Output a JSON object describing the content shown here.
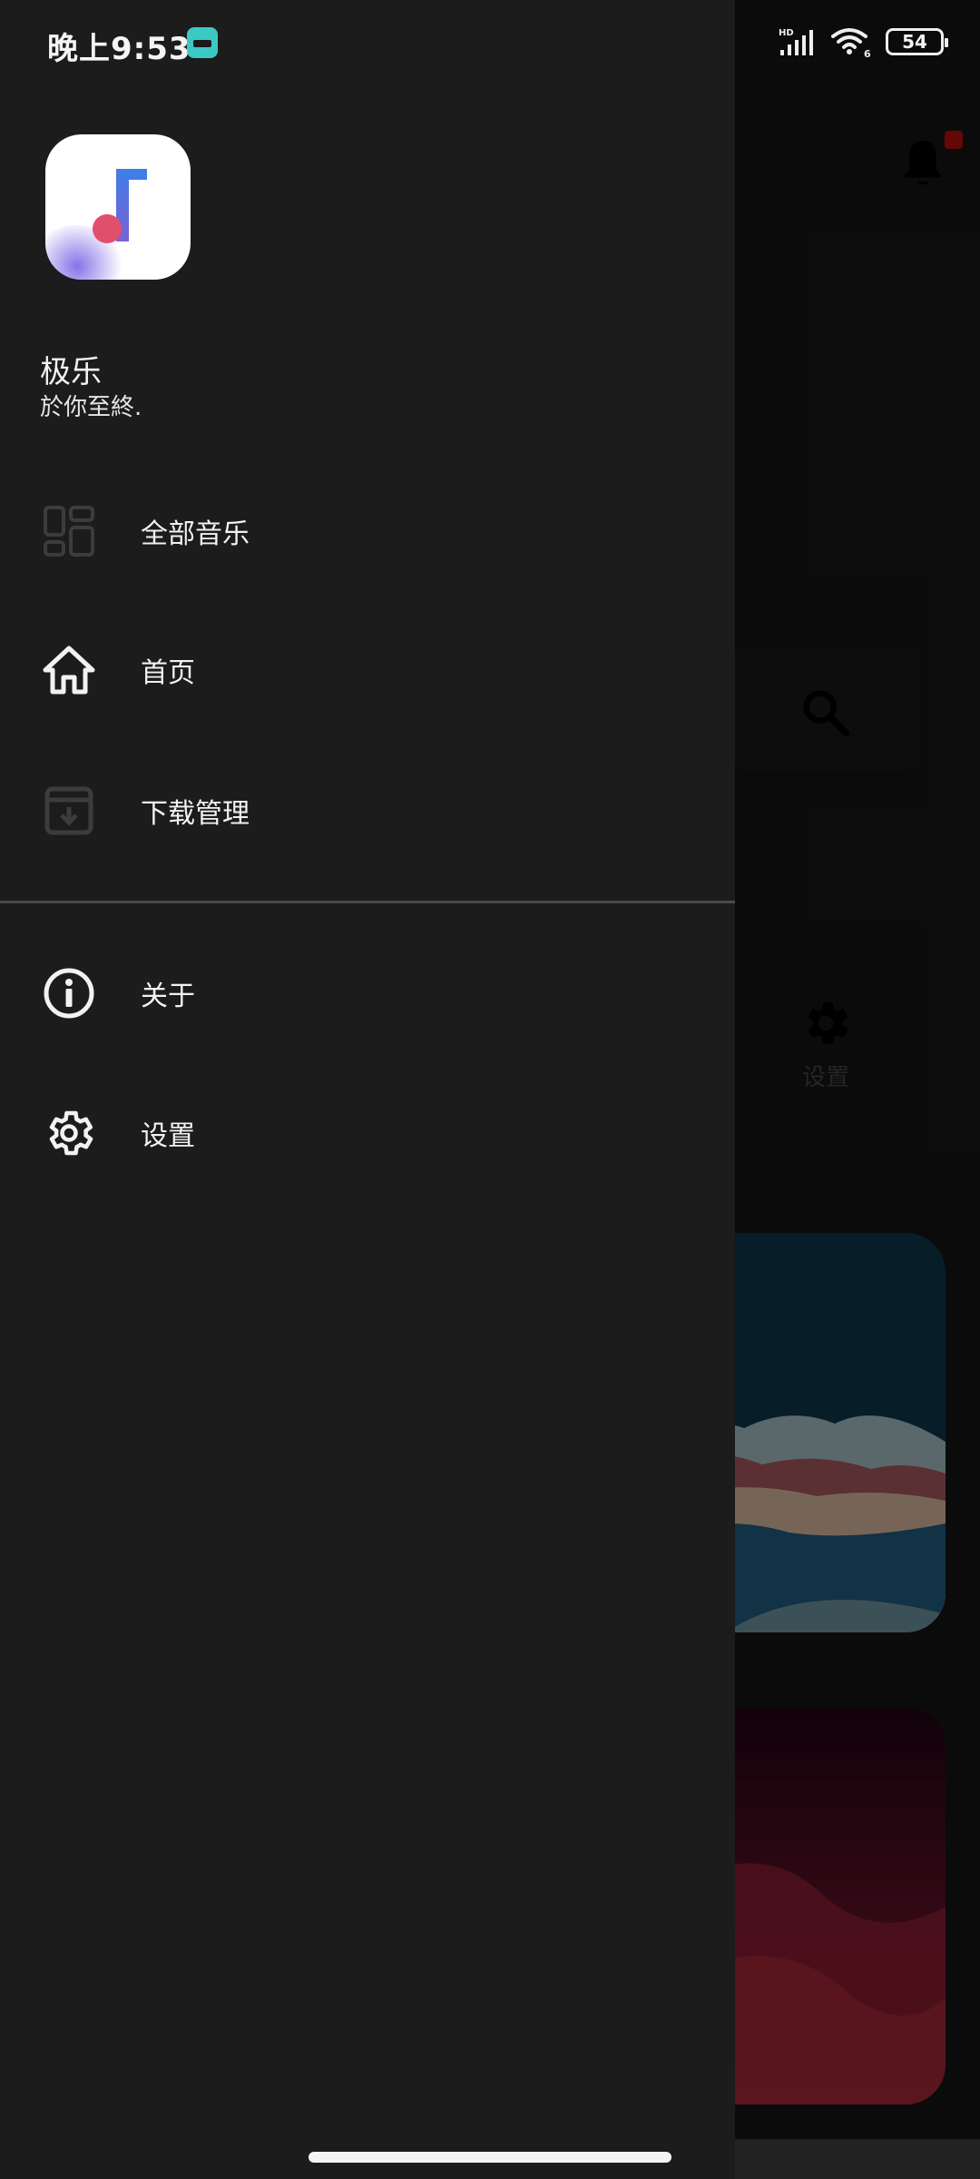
{
  "status_bar": {
    "time": "晚上9:53",
    "network_badge": "HD",
    "wifi_sub": "6",
    "battery": "54"
  },
  "drawer": {
    "app_name": "极乐",
    "slogan": "於你至終.",
    "menu": [
      {
        "label": "全部音乐",
        "icon": "grid-icon"
      },
      {
        "label": "首页",
        "icon": "home-icon"
      },
      {
        "label": "下载管理",
        "icon": "download-box-icon"
      },
      {
        "label": "关于",
        "icon": "info-icon"
      },
      {
        "label": "设置",
        "icon": "settings-gear-icon"
      }
    ]
  },
  "background": {
    "settings_label": "设置"
  },
  "colors": {
    "drawer_bg": "#1c1c1c",
    "text_primary": "#f2f2f2",
    "notify_dot": "#9b0b0b"
  }
}
